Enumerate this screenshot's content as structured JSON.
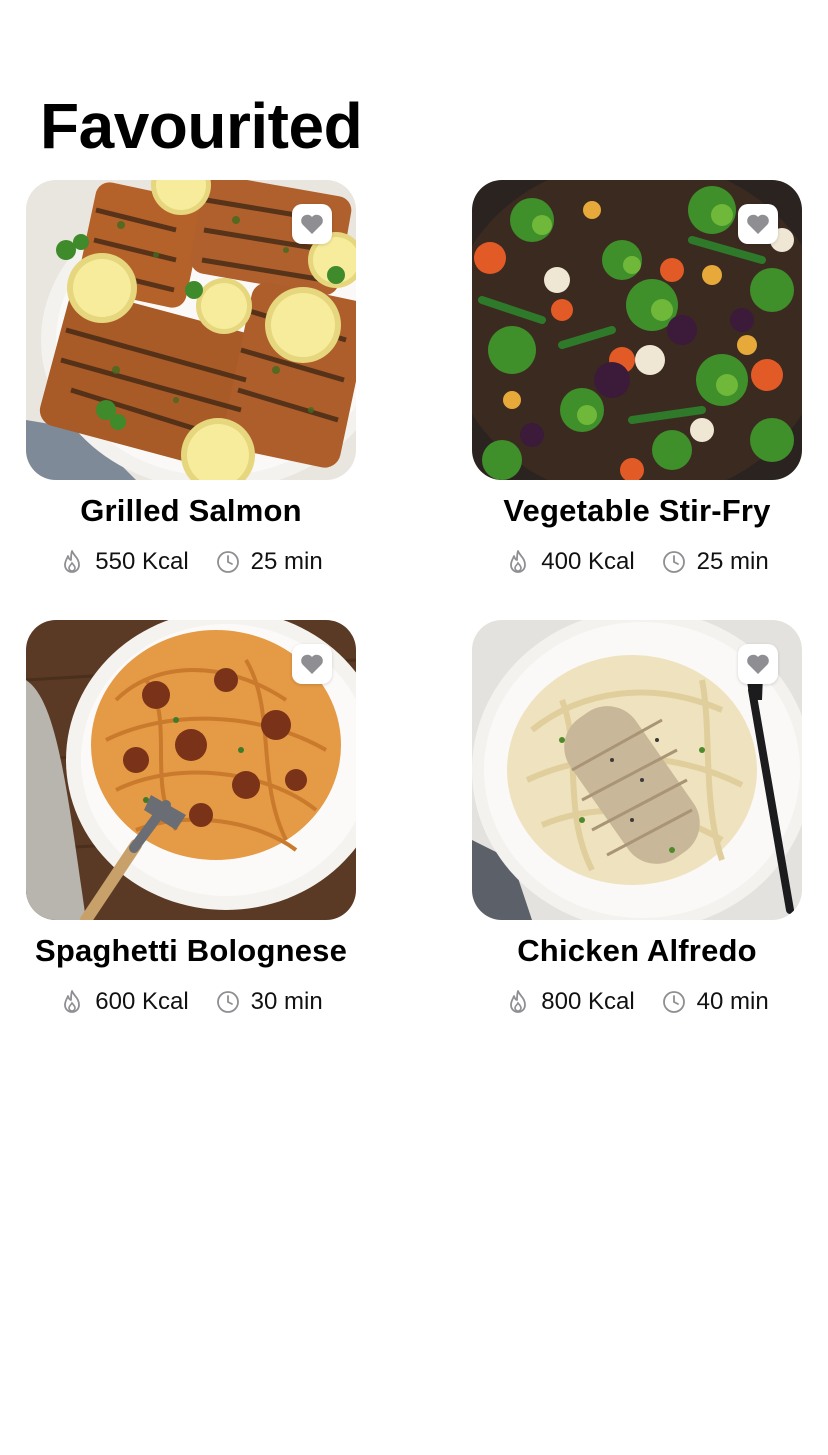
{
  "page": {
    "title": "Favourited"
  },
  "icons": {
    "favorite": "heart-icon",
    "calories": "flame-icon",
    "time": "clock-icon"
  },
  "colors": {
    "heart": "#8e8e93",
    "meta_icon": "#8e8e93"
  },
  "recipes": [
    {
      "name": "Grilled Salmon",
      "calories": "550 Kcal",
      "time": "25 min",
      "favorited": true
    },
    {
      "name": "Vegetable Stir-Fry",
      "calories": "400 Kcal",
      "time": "25 min",
      "favorited": true
    },
    {
      "name": "Spaghetti Bolognese",
      "calories": "600 Kcal",
      "time": "30 min",
      "favorited": true
    },
    {
      "name": "Chicken Alfredo",
      "calories": "800 Kcal",
      "time": "40 min",
      "favorited": true
    }
  ]
}
